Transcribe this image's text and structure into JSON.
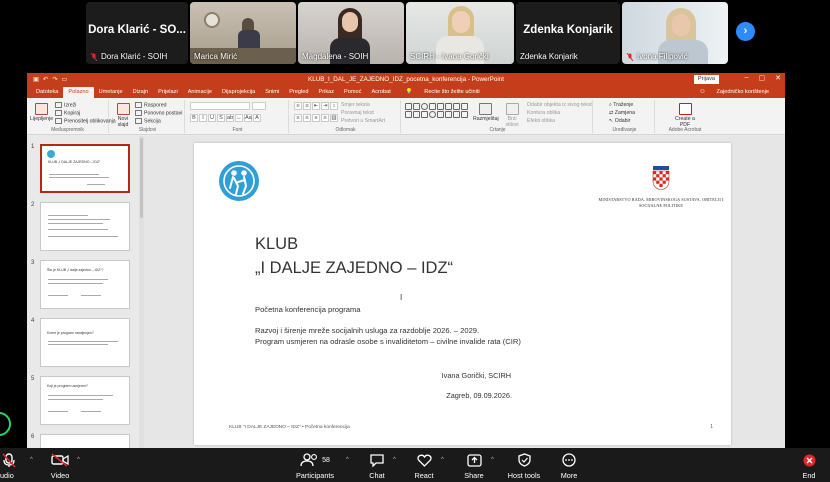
{
  "participants_strip": {
    "tiles": [
      {
        "name": "Dora Klarić - SO...",
        "caption": "Dora Klarić - SOIH",
        "muted": true
      },
      {
        "caption": "Marica Mirić",
        "muted": false
      },
      {
        "caption": "Magdalena - SOIH",
        "muted": false
      },
      {
        "caption": "SCIRH - Ivana Gorički",
        "muted": false,
        "speaking": true
      },
      {
        "name": "Zdenka Konjarik",
        "caption": "Zdenka Konjarik",
        "muted": false
      },
      {
        "caption": "Ivona Filipović",
        "muted": true
      }
    ],
    "next_icon": "chevron-right-icon"
  },
  "powerpoint": {
    "window_title": "KLUB_I_DAL_JE_ZAJEDNO_IDZ_pocetna_konferencija  -  PowerPoint",
    "account_label": "Prijava",
    "tabs": [
      "Datoteka",
      "Polazno",
      "Umetanje",
      "Dizajn",
      "Prijelazi",
      "Animacije",
      "Dijaprojekcija",
      "Snimi",
      "Pregled",
      "Prikaz",
      "Pomoć",
      "Acrobat"
    ],
    "active_tab": "Polazno",
    "tell_me": "Recite što želite učiniti",
    "share_label": "Zajedničko korištenje",
    "ribbon": {
      "clipboard": {
        "paste": "Lijepljenje",
        "cut": "Izreži",
        "copy": "Kopiraj",
        "format_painter": "Prenositelj oblikovanja",
        "group": "Međuspremnik"
      },
      "slides": {
        "new_slide": "Novi slajd",
        "layout": "Raspored",
        "reset": "Ponovno postavi",
        "section": "Sekcija",
        "group": "Slajdovi"
      },
      "font": {
        "group": "Font"
      },
      "paragraph": {
        "group": "Odlomak",
        "text_direction": "Smjer teksta",
        "align_text": "Poravnaj tekst",
        "smartart": "Pretvori u SmartArt"
      },
      "drawing": {
        "arrange": "Razmještaj",
        "quick_styles": "Brzi stilovi",
        "shape_fill": "Odabir objekta iz sivog tekst",
        "shape_outline": "Kontura oblika",
        "shape_effects": "Efekti oblika",
        "group": "Crtanje"
      },
      "editing": {
        "find": "Traženje",
        "replace": "Zamjena",
        "select": "Odabir",
        "group": "Uređivanje"
      },
      "acrobat": {
        "create_pdf": "Create a PDF",
        "group": "Adobe Acrobat"
      }
    },
    "slides_panel": {
      "numbers": [
        "1",
        "2",
        "3",
        "4",
        "5",
        "6"
      ],
      "thumb_titles": [
        "KLUB „I DALJE ZAJEDNO – IDZ“",
        "",
        "Što je KLUB „I dalje zajedno – IDZ“?",
        "Kome je program namijenjen?",
        "Koji je program usmjeren?",
        ""
      ]
    },
    "slide": {
      "ministry": "MINISTARSTVO RADA, MIROVINSKOGA SUSTAVA, OBITELJI I SOCIJALNE POLITIKE",
      "title_line1": "KLUB",
      "title_line2": "„I DALJE ZAJEDNO – IDZ“",
      "subtitle": "Početna konferencija programa",
      "line1": "Razvoj i širenje mreže socijalnih usluga za razdoblje 2026. – 2029.",
      "line2": "Program usmjeren na odrasle osobe s invaliditetom – civilne invalide rata (CIR)",
      "presenter": "Ivana Gorički, SCIRH",
      "place_date": "Zagreb, 09.09.2026.",
      "footer": "KLUB \"I DALJE ZAJEDNO – IDZ\"  •  Početna konferencija",
      "slide_number": "1"
    }
  },
  "toolbar": {
    "audio": "udio",
    "video": "Video",
    "participants": "Participants",
    "participants_count": "58",
    "chat": "Chat",
    "react": "React",
    "share": "Share",
    "host_tools": "Host tools",
    "more": "More",
    "end": "End"
  },
  "colors": {
    "ppt_accent": "#c43e1c",
    "speaking_border": "#23d959",
    "zoom_blue": "#2d8cff",
    "end_red": "#e02828"
  }
}
